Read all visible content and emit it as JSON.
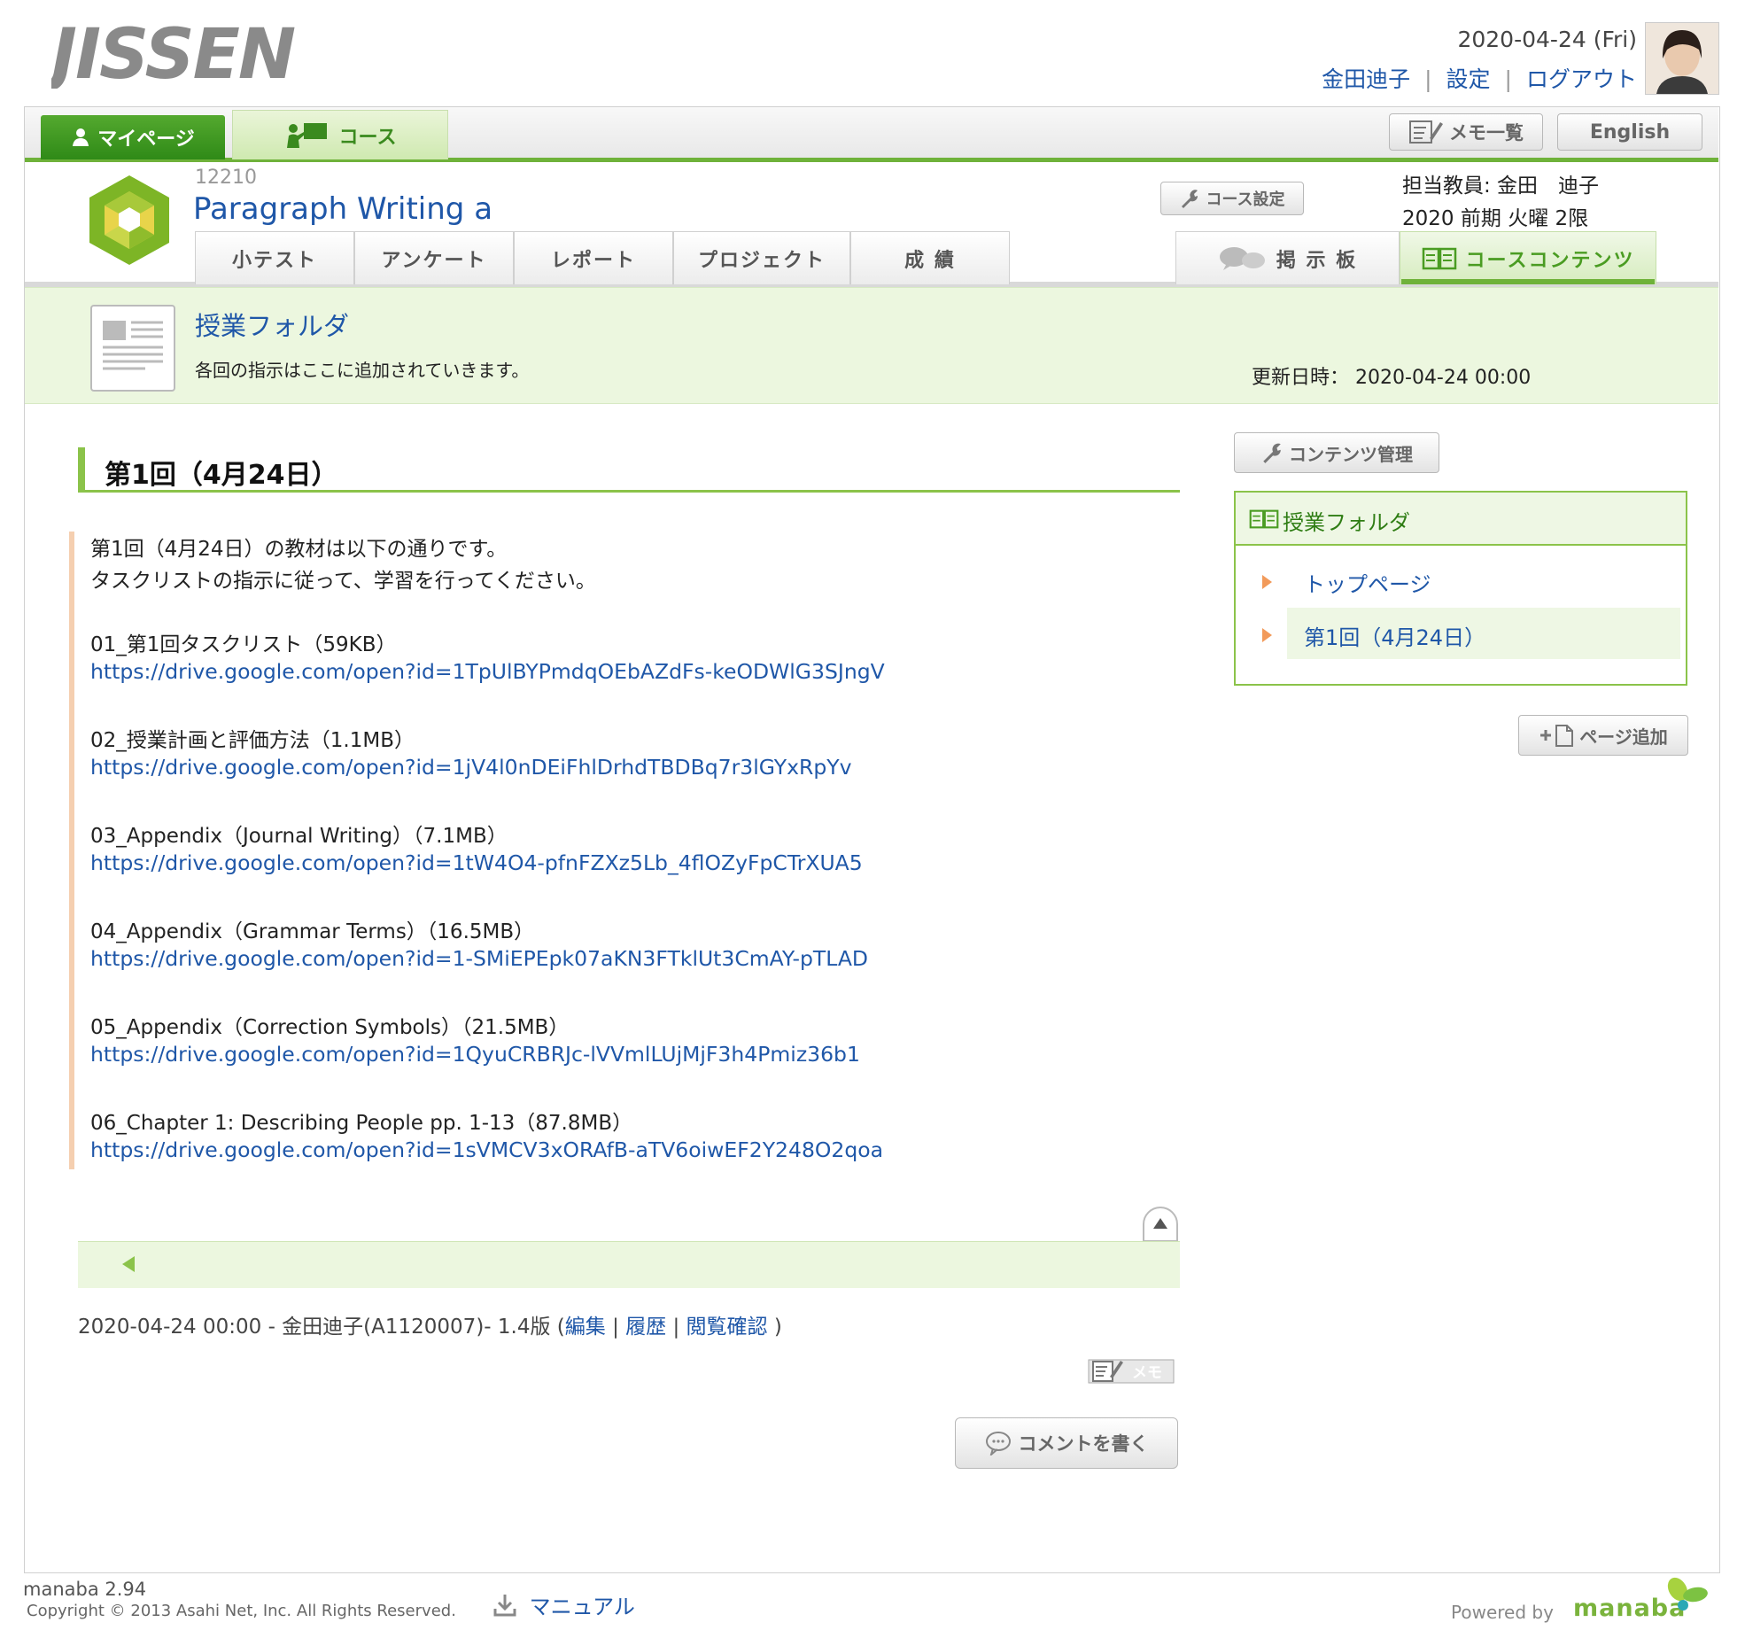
{
  "header": {
    "logo_text": "JISSEN",
    "date": "2020-04-24 (Fri)",
    "user_name": "金田迪子",
    "settings_label": "設定",
    "logout_label": "ログアウト",
    "separator": "|"
  },
  "topnav": {
    "mypage_label": "マイページ",
    "course_label": "コース",
    "memo_list_label": "メモ一覧",
    "english_label": "English"
  },
  "course": {
    "code": "12210",
    "title": "Paragraph Writing a",
    "settings_label": "コース設定",
    "teacher_line": "担当教員: 金田　迪子",
    "term_line": "2020 前期 火曜 2限",
    "tabs": [
      "小テスト",
      "アンケート",
      "レポート",
      "プロジェクト",
      "成 績"
    ],
    "tab_board": "掲 示 板",
    "tab_contents": "コースコンテンツ"
  },
  "folder": {
    "title": "授業フォルダ",
    "description": "各回の指示はここに追加されていきます。",
    "updated_label": "更新日時：",
    "updated_value": "2020-04-24 00:00"
  },
  "page": {
    "section_title": "第1回（4月24日）",
    "intro_1": "第1回（4月24日）の教材は以下の通りです。",
    "intro_2": "タスクリストの指示に従って、学習を行ってください。",
    "items": [
      {
        "label": "01_第1回タスクリスト（59KB）",
        "url": "https://drive.google.com/open?id=1TpUlBYPmdqOEbAZdFs-keODWlG3SJngV"
      },
      {
        "label": "02_授業計画と評価方法（1.1MB）",
        "url": "https://drive.google.com/open?id=1jV4l0nDEiFhlDrhdTBDBq7r3lGYxRpYv"
      },
      {
        "label": "03_Appendix（Journal Writing）（7.1MB）",
        "url": "https://drive.google.com/open?id=1tW4O4-pfnFZXz5Lb_4flOZyFpCTrXUA5"
      },
      {
        "label": "04_Appendix（Grammar Terms）（16.5MB）",
        "url": "https://drive.google.com/open?id=1-SMiEPEpk07aKN3FTklUt3CmAY-pTLAD"
      },
      {
        "label": "05_Appendix（Correction Symbols）（21.5MB）",
        "url": "https://drive.google.com/open?id=1QyuCRBRJc-lVVmlLUjMjF3h4Pmiz36b1"
      },
      {
        "label": "06_Chapter 1: Describing People pp. 1-13（87.8MB）",
        "url": "https://drive.google.com/open?id=1sVMCV3xORAfB-aTV6oiwEF2Y248O2qoa"
      }
    ],
    "meta_prefix": "2020-04-24 00:00 - 金田迪子(A1120007)- 1.4版 (",
    "meta_edit": "編集",
    "meta_history": "履歴",
    "meta_view": "閲覧確認",
    "meta_suffix": " )",
    "memo_label": "メモ",
    "comment_label": "コメントを書く"
  },
  "sidebar": {
    "content_mgmt_label": "コンテンツ管理",
    "folder_title": "授業フォルダ",
    "items": [
      "トップページ",
      "第1回（4月24日）"
    ],
    "page_add_label": "ページ追加"
  },
  "footer": {
    "version": "manaba 2.94",
    "copyright": "Copyright © 2013 Asahi Net, Inc. All Rights Reserved.",
    "manual_label": "マニュアル",
    "powered_by": "Powered by",
    "brand": "manaba"
  },
  "colors": {
    "accent_green": "#6fb23a",
    "link_blue": "#1f57a8",
    "banner_bg": "#ecf7df"
  }
}
